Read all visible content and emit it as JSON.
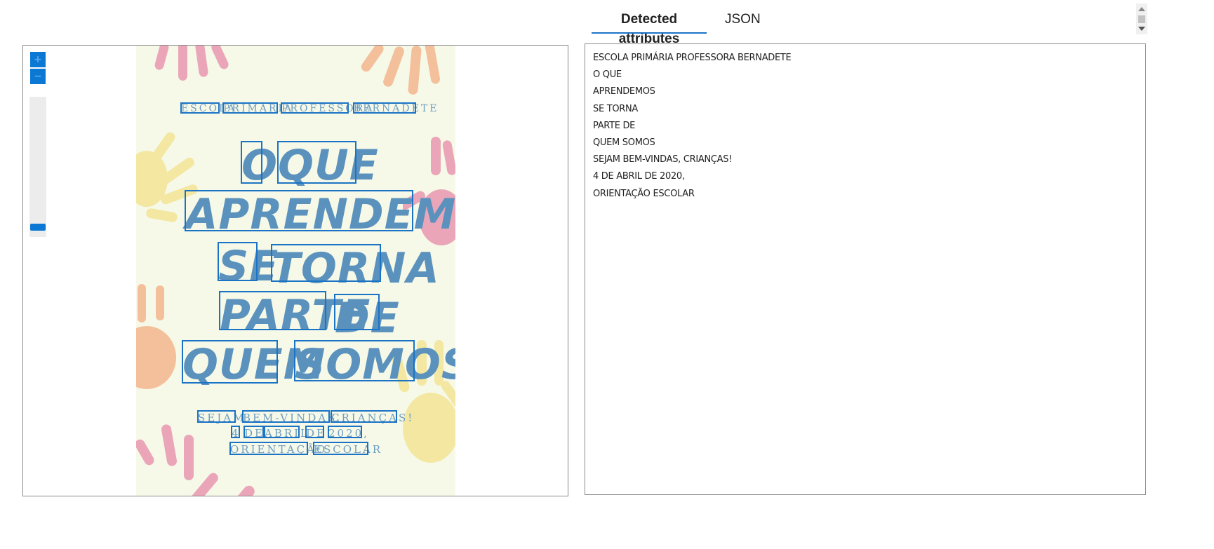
{
  "viewer": {
    "zoom_in_label": "+",
    "zoom_out_label": "−",
    "zoom_level": 0.0
  },
  "poster": {
    "small_top": [
      "ESCOLA",
      "PRIMÁRIA",
      "PROFESSORA",
      "BERNADETE"
    ],
    "big_lines": [
      [
        "O",
        "QUE"
      ],
      [
        "APRENDEMOS"
      ],
      [
        "SE",
        "TORNA"
      ],
      [
        "PARTE",
        "DE"
      ],
      [
        "QUEM",
        "SOMOS"
      ]
    ],
    "small_bottom": [
      [
        "SEJAM",
        "BEM-VINDAS,",
        "CRIANÇAS!"
      ],
      [
        "4",
        "DE",
        "ABRIL",
        "DE",
        "2020,"
      ],
      [
        "ORIENTAÇÃO",
        "ESCOLAR"
      ]
    ],
    "colors": {
      "background": "#f6f9e8",
      "text": "#5b92bd",
      "box": "#1b73c6",
      "hand_pink": "#eaa6b8",
      "hand_yellow": "#f3e7a2",
      "hand_orange": "#f4c09b"
    }
  },
  "tabs": {
    "detected": "Detected attributes",
    "json": "JSON"
  },
  "attributes": [
    "ESCOLA PRIMÁRIA PROFESSORA BERNADETE",
    "O QUE",
    "APRENDEMOS",
    "SE TORNA",
    "PARTE DE",
    "QUEM SOMOS",
    "SEJAM BEM-VINDAS, CRIANÇAS!",
    "4 DE ABRIL DE 2020,",
    "ORIENTAÇÃO ESCOLAR"
  ]
}
